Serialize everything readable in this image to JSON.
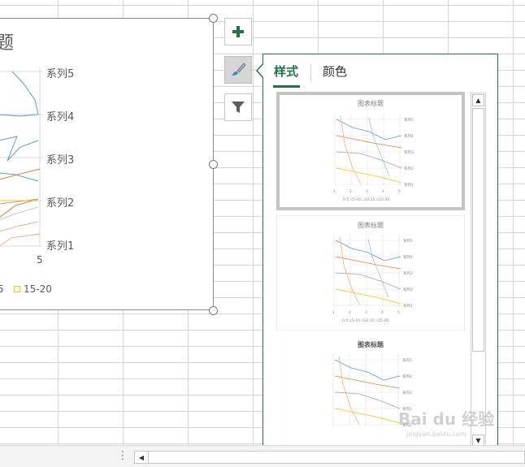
{
  "chart": {
    "title_fragment": "题",
    "series_labels": [
      "系列5",
      "系列4",
      "系列3",
      "系列2",
      "系列1"
    ],
    "x_tick": "5",
    "legend": [
      {
        "label": "5"
      },
      {
        "label": "15-20"
      }
    ]
  },
  "side_buttons": [
    {
      "icon": "plus-icon"
    },
    {
      "icon": "brush-icon"
    },
    {
      "icon": "filter-icon"
    }
  ],
  "panel": {
    "tabs": [
      {
        "label": "样式",
        "active": true
      },
      {
        "label": "颜色",
        "active": false
      }
    ],
    "styles": [
      {
        "title": "图表标题",
        "selected": true
      },
      {
        "title": "图表标题",
        "selected": false
      },
      {
        "title": "图表标题",
        "selected": false
      }
    ],
    "thumb_series": [
      "系列5",
      "系列4",
      "系列3",
      "系列2",
      "系列1"
    ],
    "thumb_x_ticks": [
      "1",
      "2",
      "3",
      "4",
      "5"
    ],
    "thumb_legend": [
      "0-5",
      "5-10",
      "10-15",
      "15-20"
    ]
  },
  "watermark": {
    "text": "Bai du 经验",
    "sub": "jingyan.baidu.com"
  },
  "colors": {
    "accent": "#217346",
    "series_blue": "#5b9bd5",
    "series_orange": "#ed7d31",
    "series_gray": "#a5a5a5",
    "series_yellow": "#ffc000"
  }
}
